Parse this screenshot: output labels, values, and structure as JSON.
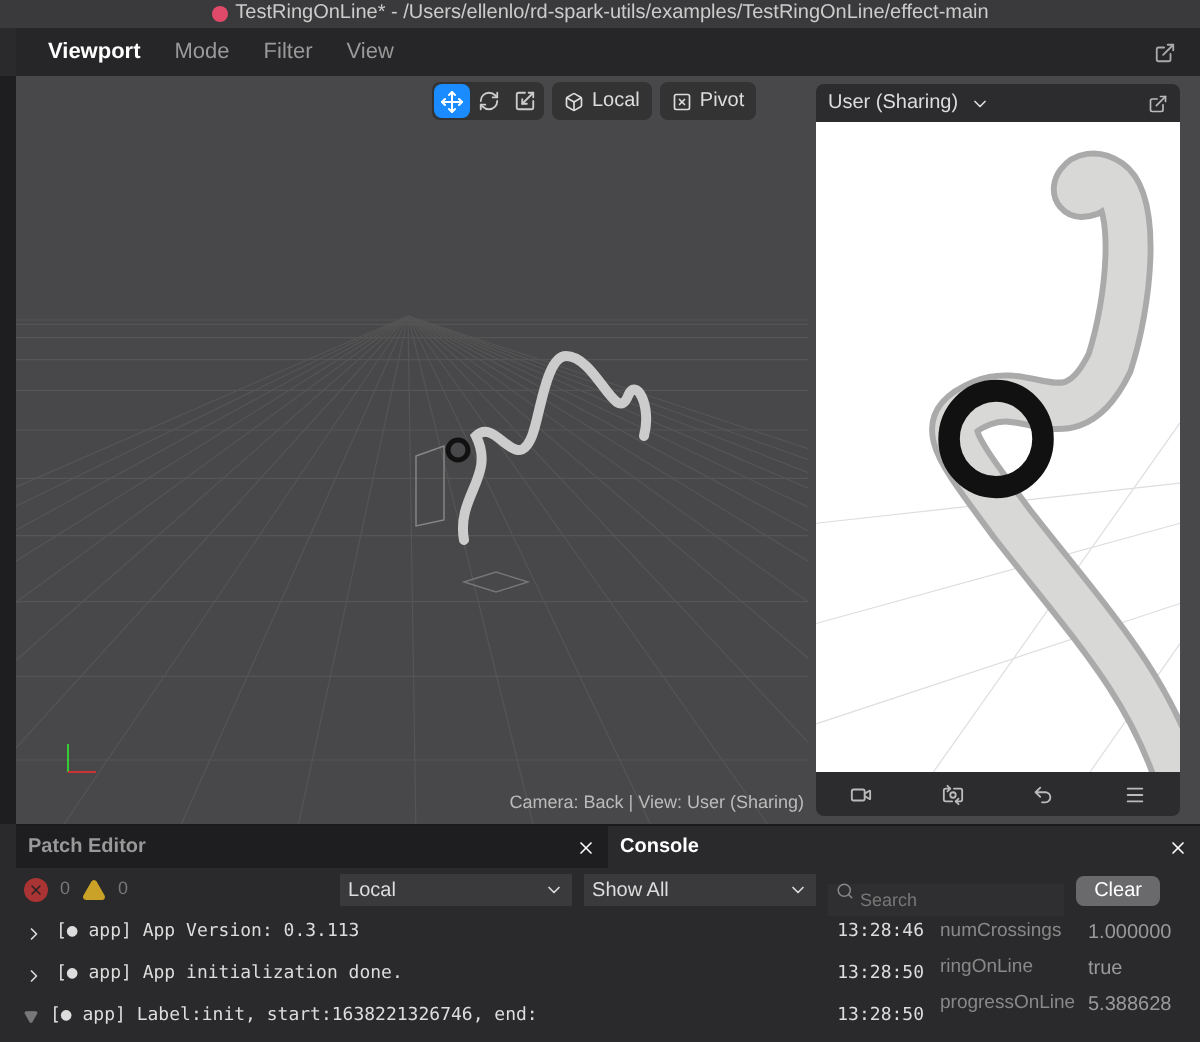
{
  "window": {
    "title": "TestRingOnLine* - /Users/ellenlo/rd-spark-utils/examples/TestRingOnLine/effect-main"
  },
  "menu": [
    {
      "label": "Viewport",
      "selected": true
    },
    {
      "label": "Mode",
      "selected": false
    },
    {
      "label": "Filter",
      "selected": false
    },
    {
      "label": "View",
      "selected": false
    }
  ],
  "transform_tools": [
    {
      "kind": "move",
      "selected": true
    },
    {
      "kind": "rotate",
      "selected": false
    },
    {
      "kind": "scale",
      "selected": false
    }
  ],
  "space_button": "Local",
  "pivot_button": "Pivot",
  "camera_caption": "Camera: Back | View: User (Sharing)",
  "preview": {
    "device": "User (Sharing)"
  },
  "bottom_tabs": [
    {
      "label": "Patch Editor",
      "selected": false
    },
    {
      "label": "Console",
      "selected": true
    }
  ],
  "error_count": "0",
  "warning_count": "0",
  "scope_select": "Local",
  "level_select": "Show All",
  "search": {
    "placeholder": "Search"
  },
  "clear_button": "Clear",
  "logs": [
    {
      "kind": "collapsed",
      "message": "[● app] App Version: 0.3.113",
      "time": "13:28:46"
    },
    {
      "kind": "collapsed",
      "message": "[● app] App initialization done.",
      "time": "13:28:50"
    },
    {
      "kind": "expanded",
      "message": "[● app] Label:init, start:1638221326746, end:",
      "time": "13:28:50"
    }
  ],
  "watches": [
    {
      "name": "numCrossings",
      "value": "1.000000"
    },
    {
      "name": "ringOnLine",
      "value": "true"
    },
    {
      "name": "progressOnLine",
      "value": "5.388628"
    }
  ]
}
